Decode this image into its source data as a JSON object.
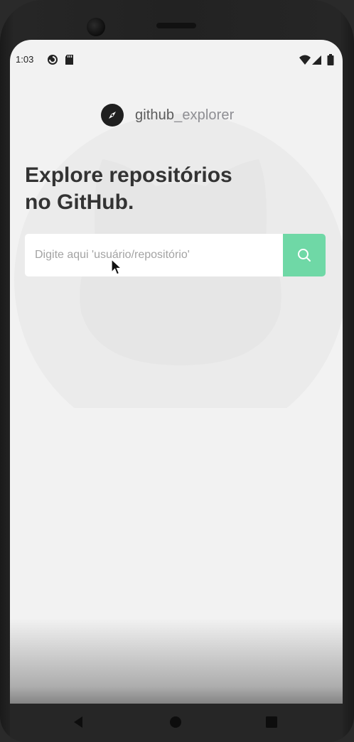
{
  "status_bar": {
    "time": "1:03",
    "icons": [
      "pocketcasts-icon",
      "sd-card-icon",
      "wifi-icon",
      "cellular-signal-icon",
      "battery-icon"
    ]
  },
  "app": {
    "brand_main": "github",
    "brand_suffix": "_explorer",
    "logo_icon": "compass-icon",
    "headline_line1": "Explore repositórios",
    "headline_line2": "no GitHub.",
    "search": {
      "placeholder": "Digite aqui 'usuário/repositório'",
      "value": "",
      "button_icon": "search-icon"
    }
  },
  "nav_bar": {
    "buttons": [
      "back-icon",
      "home-icon",
      "recents-icon"
    ]
  },
  "colors": {
    "background": "#f2f2f2",
    "accent": "#6fd8a6",
    "heading": "#333333",
    "brand_text": "#5b5b5b",
    "brand_suffix": "#8e8e93",
    "placeholder": "#a3a3a3"
  }
}
